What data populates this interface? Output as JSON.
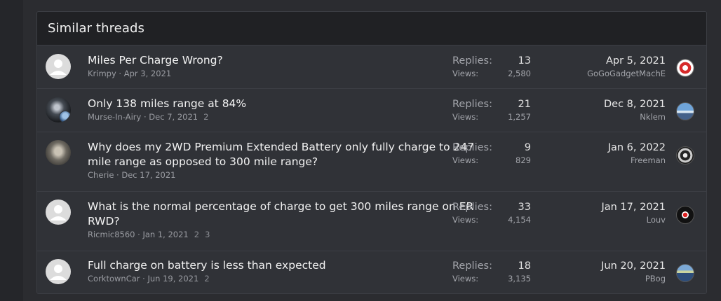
{
  "section_title": "Similar threads",
  "labels": {
    "replies": "Replies:",
    "views": "Views:"
  },
  "threads": [
    {
      "title": "Miles Per Charge Wrong?",
      "author": "Krimpy",
      "started": "Apr 3, 2021",
      "pages": [],
      "replies": "13",
      "views": "2,580",
      "last_date": "Apr 5, 2021",
      "last_user": "GoGoGadgetMachE",
      "avatar": "default-avatar-icon",
      "last_avatar": "red-logo-avatar-icon"
    },
    {
      "title": "Only 138 miles range at 84%",
      "author": "Murse-In-Airy",
      "started": "Dec 7, 2021",
      "pages": [
        "2"
      ],
      "replies": "21",
      "views": "1,257",
      "last_date": "Dec 8, 2021",
      "last_user": "Nklem",
      "avatar": "photo-avatar-icon",
      "last_avatar": "sky-photo-avatar-icon"
    },
    {
      "title": "Why does my 2WD Premium Extended Battery only fully charge to 247 mile range as opposed to 300 mile range?",
      "author": "Cherie",
      "started": "Dec 17, 2021",
      "pages": [],
      "replies": "9",
      "views": "829",
      "last_date": "Jan 6, 2022",
      "last_user": "Freeman",
      "avatar": "photo-avatar-icon",
      "last_avatar": "car-photo-avatar-icon"
    },
    {
      "title": "What is the normal percentage of charge to get 300 miles range on ER RWD?",
      "author": "Ricmic8560",
      "started": "Jan 1, 2021",
      "pages": [
        "2",
        "3"
      ],
      "replies": "33",
      "views": "4,154",
      "last_date": "Jan 17, 2021",
      "last_user": "Louv",
      "avatar": "default-avatar-icon",
      "last_avatar": "dark-logo-avatar-icon"
    },
    {
      "title": "Full charge on battery is less than expected",
      "author": "CorktownCar",
      "started": "Jun 19, 2021",
      "pages": [
        "2"
      ],
      "replies": "18",
      "views": "3,135",
      "last_date": "Jun 20, 2021",
      "last_user": "PBog",
      "avatar": "default-avatar-icon",
      "last_avatar": "earth-photo-avatar-icon"
    }
  ]
}
